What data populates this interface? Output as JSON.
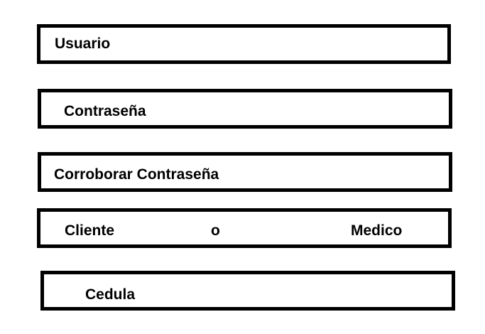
{
  "form": {
    "usuario_label": "Usuario",
    "contrasena_label": "Contraseña",
    "corroborar_label": "Corroborar Contraseña",
    "tipo": {
      "cliente_label": "Cliente",
      "separator": "o",
      "medico_label": "Medico"
    },
    "cedula_label": "Cedula"
  },
  "colors": {
    "border": "#000000",
    "background": "#ffffff",
    "text": "#000000"
  }
}
